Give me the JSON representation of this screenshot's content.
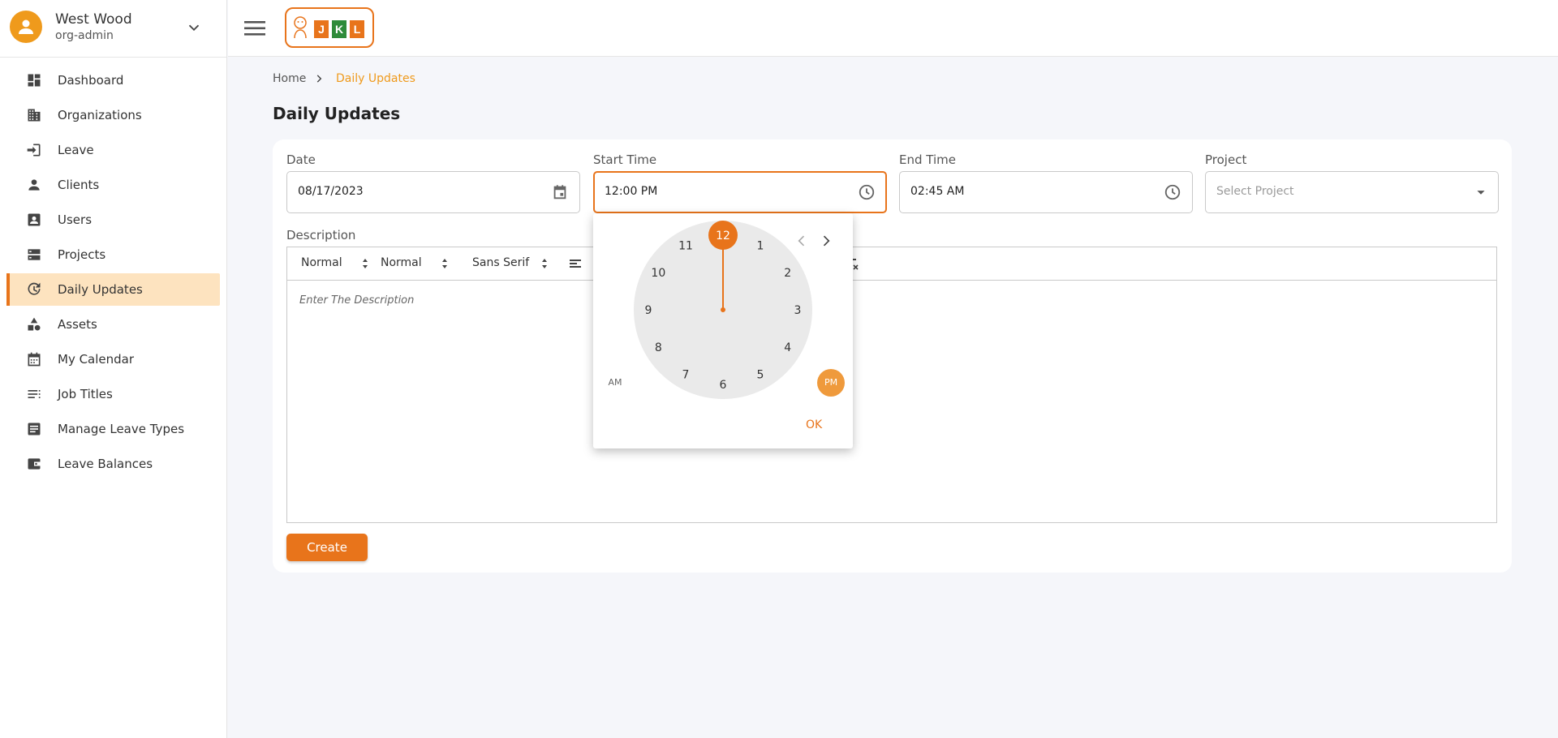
{
  "user": {
    "name": "West Wood",
    "role": "org-admin"
  },
  "nav": [
    {
      "label": "Dashboard",
      "icon": "dashboard-icon"
    },
    {
      "label": "Organizations",
      "icon": "organizations-icon"
    },
    {
      "label": "Leave",
      "icon": "leave-icon"
    },
    {
      "label": "Clients",
      "icon": "clients-icon"
    },
    {
      "label": "Users",
      "icon": "users-icon"
    },
    {
      "label": "Projects",
      "icon": "projects-icon"
    },
    {
      "label": "Daily Updates",
      "icon": "daily-updates-icon",
      "active": true
    },
    {
      "label": "Assets",
      "icon": "assets-icon"
    },
    {
      "label": "My Calendar",
      "icon": "calendar-icon"
    },
    {
      "label": "Job Titles",
      "icon": "job-titles-icon"
    },
    {
      "label": "Manage Leave Types",
      "icon": "leave-types-icon"
    },
    {
      "label": "Leave Balances",
      "icon": "wallet-icon"
    }
  ],
  "logo_text": [
    "J",
    "K",
    "L"
  ],
  "breadcrumb": {
    "home": "Home",
    "current": "Daily Updates"
  },
  "page_title": "Daily Updates",
  "form": {
    "date": {
      "label": "Date",
      "value": "08/17/2023"
    },
    "start_time": {
      "label": "Start Time",
      "value": "12:00 PM"
    },
    "end_time": {
      "label": "End Time",
      "value": "02:45 AM"
    },
    "project": {
      "label": "Project",
      "placeholder": "Select Project"
    },
    "description": {
      "label": "Description",
      "placeholder": "Enter The Description",
      "toolbar": {
        "header": "Normal",
        "size": "Normal",
        "font": "Sans Serif"
      }
    },
    "create_label": "Create"
  },
  "time_picker": {
    "selected_hour": "12",
    "hours": [
      "12",
      "1",
      "2",
      "3",
      "4",
      "5",
      "6",
      "7",
      "8",
      "9",
      "10",
      "11"
    ],
    "am_label": "AM",
    "pm_label": "PM",
    "meridiem": "PM",
    "ok_label": "OK"
  },
  "colors": {
    "accent": "#e8741b",
    "accent_light": "#ef9a1c",
    "active_bg": "#fde3bf"
  }
}
